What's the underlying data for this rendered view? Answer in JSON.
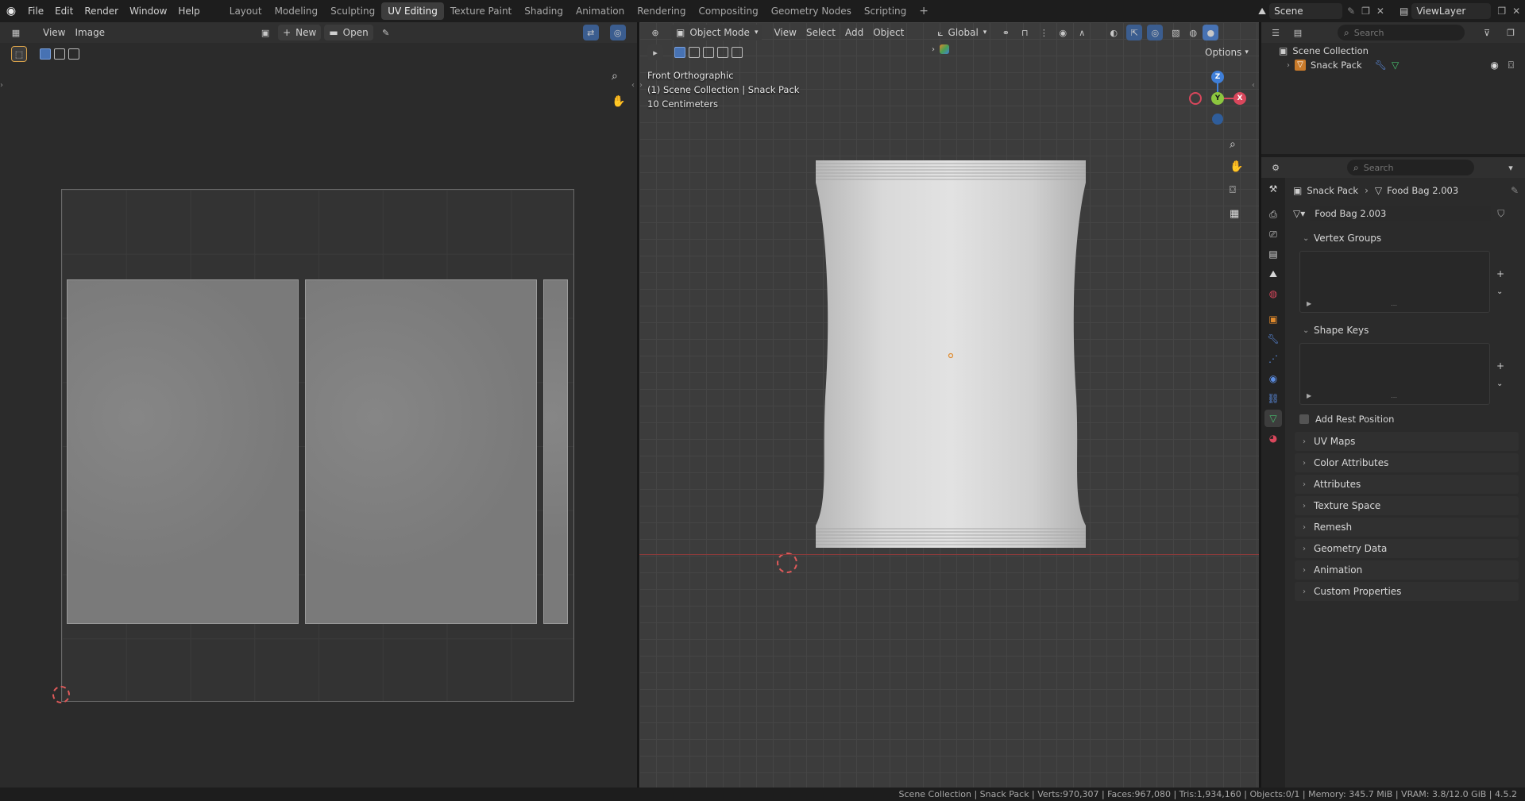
{
  "topbar": {
    "menus": [
      "File",
      "Edit",
      "Render",
      "Window",
      "Help"
    ],
    "workspaces": [
      "Layout",
      "Modeling",
      "Sculpting",
      "UV Editing",
      "Texture Paint",
      "Shading",
      "Animation",
      "Rendering",
      "Compositing",
      "Geometry Nodes",
      "Scripting"
    ],
    "active_workspace": "UV Editing",
    "add_tab": "+",
    "scene": "Scene",
    "view_layer": "ViewLayer"
  },
  "uv_editor": {
    "menus": [
      "View",
      "Image"
    ],
    "new_label": "New",
    "open_label": "Open"
  },
  "viewport": {
    "mode": "Object Mode",
    "menus": [
      "View",
      "Select",
      "Add",
      "Object"
    ],
    "orientation": "Global",
    "options": "Options",
    "info_line1": "Front Orthographic",
    "info_line2": "(1) Scene Collection | Snack Pack",
    "info_line3": "10 Centimeters",
    "gizmo": {
      "z": "Z",
      "y": "Y",
      "x": "X"
    }
  },
  "outliner": {
    "search_placeholder": "Search",
    "root": "Scene Collection",
    "item": "Snack Pack"
  },
  "properties": {
    "search_placeholder": "Search",
    "breadcrumb_object": "Snack Pack",
    "breadcrumb_data": "Food Bag 2.003",
    "mesh_name": "Food Bag 2.003",
    "vertex_groups": "Vertex Groups",
    "shape_keys": "Shape Keys",
    "add_rest_position": "Add Rest Position",
    "panels": [
      "UV Maps",
      "Color Attributes",
      "Attributes",
      "Texture Space",
      "Remesh",
      "Geometry Data",
      "Animation",
      "Custom Properties"
    ]
  },
  "statusbar": {
    "text": "Scene Collection | Snack Pack | Verts:970,307 | Faces:967,080 | Tris:1,934,160 | Objects:0/1 | Memory: 345.7 MiB | VRAM: 3.8/12.0 GiB | 4.5.2"
  },
  "colors": {
    "accent": "#4772b3",
    "x_axis": "#d9475c",
    "y_axis": "#8cc63f",
    "z_axis": "#3f7fd9"
  }
}
